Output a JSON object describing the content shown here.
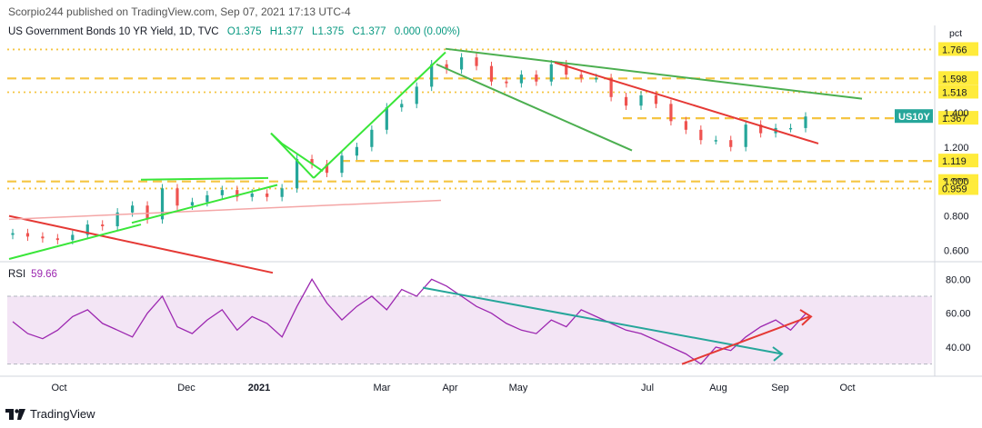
{
  "header": {
    "publisher": "Scorpio244 published on TradingView.com, Sep 07, 2021 17:13 UTC-4"
  },
  "legend": {
    "title": "US Government Bonds 10 YR Yield, 1D, TVC",
    "o": "O1.375",
    "h": "H1.377",
    "l": "L1.375",
    "c": "C1.377",
    "chg": "0.000 (0.00%)"
  },
  "rsi": {
    "label": "RSI",
    "value": "59.66"
  },
  "footer": {
    "brand": "TradingView"
  },
  "colors": {
    "up": "#26a69a",
    "down": "#ef5350",
    "rsi": "#9c27b0",
    "rsi_band": "#f3e5f5",
    "level": "#f5c542",
    "green_line": "#4caf50",
    "bright_green": "#39e639",
    "red_line": "#e53935",
    "teal_arrow": "#26a69a",
    "price_tag": "#ffeb3b",
    "symbol_tag": "#26a69a"
  },
  "chart_data": [
    {
      "type": "candlestick",
      "title": "US Government Bonds 10 YR Yield, 1D, TVC",
      "unit": "pct",
      "x": [
        "2020-09-01",
        "2020-09-08",
        "2020-09-15",
        "2020-09-22",
        "2020-09-29",
        "2020-10-06",
        "2020-10-13",
        "2020-10-20",
        "2020-10-27",
        "2020-11-03",
        "2020-11-10",
        "2020-11-17",
        "2020-11-24",
        "2020-12-01",
        "2020-12-08",
        "2020-12-15",
        "2020-12-22",
        "2020-12-29",
        "2021-01-05",
        "2021-01-12",
        "2021-01-19",
        "2021-01-26",
        "2021-02-02",
        "2021-02-09",
        "2021-02-16",
        "2021-02-23",
        "2021-03-02",
        "2021-03-09",
        "2021-03-16",
        "2021-03-23",
        "2021-03-30",
        "2021-04-06",
        "2021-04-13",
        "2021-04-20",
        "2021-04-27",
        "2021-05-04",
        "2021-05-11",
        "2021-05-18",
        "2021-05-25",
        "2021-06-01",
        "2021-06-08",
        "2021-06-15",
        "2021-06-22",
        "2021-06-29",
        "2021-07-06",
        "2021-07-13",
        "2021-07-20",
        "2021-07-27",
        "2021-08-03",
        "2021-08-10",
        "2021-08-17",
        "2021-08-24",
        "2021-08-31",
        "2021-09-07"
      ],
      "close": [
        0.7,
        0.68,
        0.67,
        0.66,
        0.69,
        0.75,
        0.74,
        0.82,
        0.86,
        0.78,
        0.96,
        0.86,
        0.88,
        0.92,
        0.95,
        0.91,
        0.93,
        0.91,
        0.96,
        1.13,
        1.1,
        1.05,
        1.15,
        1.2,
        1.3,
        1.43,
        1.45,
        1.55,
        1.68,
        1.65,
        1.72,
        1.67,
        1.58,
        1.57,
        1.62,
        1.58,
        1.68,
        1.62,
        1.6,
        1.6,
        1.49,
        1.44,
        1.5,
        1.45,
        1.35,
        1.3,
        1.24,
        1.24,
        1.2,
        1.33,
        1.28,
        1.31,
        1.31,
        1.377
      ],
      "ylim": [
        0.55,
        1.8
      ],
      "ticks": [
        "0.600",
        "0.800",
        "1.000",
        "1.200",
        "1.400"
      ],
      "levels": [
        "1.766",
        "1.598",
        "1.518",
        "1.367",
        "1.119",
        "1.000",
        "0.959"
      ],
      "symbol_tag": "US10Y",
      "axis_unit_label": "pct",
      "x_ticks": [
        "Oct",
        "Dec",
        "2021",
        "Mar",
        "Apr",
        "May",
        "Jul",
        "Aug",
        "Sep",
        "Oct"
      ]
    },
    {
      "type": "line",
      "title": "RSI",
      "name": "RSI",
      "last_value": 59.66,
      "values": [
        55,
        48,
        45,
        50,
        58,
        62,
        54,
        50,
        46,
        60,
        70,
        52,
        48,
        56,
        62,
        50,
        58,
        54,
        46,
        64,
        80,
        66,
        56,
        64,
        70,
        62,
        74,
        70,
        80,
        76,
        70,
        64,
        60,
        54,
        50,
        48,
        56,
        52,
        62,
        58,
        54,
        50,
        48,
        44,
        40,
        36,
        30,
        40,
        38,
        46,
        52,
        56,
        50,
        59.66
      ],
      "ylim": [
        25,
        85
      ],
      "ticks": [
        "40.00",
        "60.00",
        "80.00"
      ],
      "band": [
        30,
        70
      ]
    }
  ]
}
